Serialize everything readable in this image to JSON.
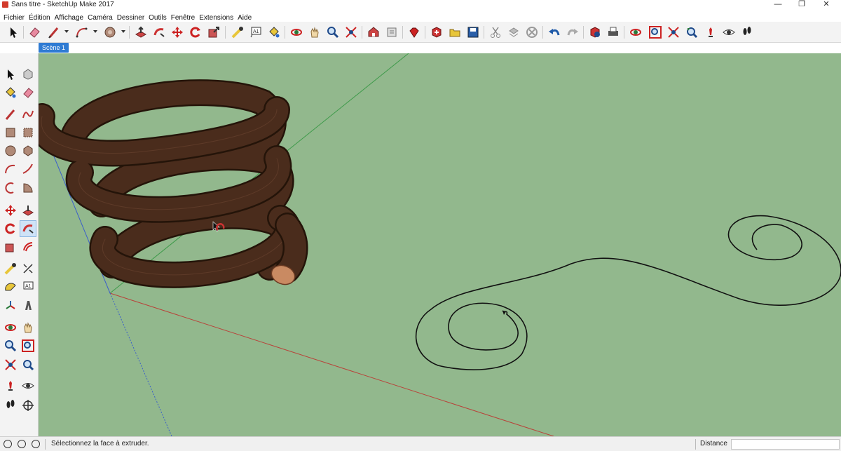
{
  "window": {
    "title": "Sans titre - SketchUp Make 2017",
    "minimize_glyph": "—",
    "maximize_glyph": "❐",
    "close_glyph": "✕"
  },
  "menu": [
    "Fichier",
    "Édition",
    "Affichage",
    "Caméra",
    "Dessiner",
    "Outils",
    "Fenêtre",
    "Extensions",
    "Aide"
  ],
  "toolbar_icons": [
    "select-icon",
    "eraser-icon",
    "line-icon",
    "arc-icon",
    "circle-icon",
    "push-pull-icon",
    "follow-me-icon",
    "move-icon",
    "rotate-icon",
    "scale-icon",
    "tape-measure-icon",
    "text-icon",
    "paint-bucket-icon",
    "orbit-icon",
    "pan-icon",
    "zoom-icon",
    "zoom-extents-icon",
    "warehouse-icon",
    "extension-warehouse-icon",
    "ruby-icon",
    "new-icon",
    "open-icon",
    "save-icon",
    "cut-icon",
    "copy-icon",
    "delete-icon",
    "undo-icon",
    "redo-icon",
    "model-info-icon",
    "print-icon",
    "orbit-icon",
    "zoom-window-icon",
    "zoom-extents-icon",
    "previous-view-icon",
    "position-camera-icon",
    "look-around-icon",
    "walk-icon"
  ],
  "scene": {
    "tab_label": "Scène 1"
  },
  "left_tools": [
    "select-icon",
    "make-component-icon",
    "paint-bucket-icon",
    "eraser-icon",
    "line-icon",
    "freehand-icon",
    "rectangle-icon",
    "rotated-rectangle-icon",
    "circle-icon",
    "polygon-icon",
    "arc-icon",
    "two-point-arc-icon",
    "three-point-arc-icon",
    "pie-icon",
    "move-icon",
    "push-pull-icon",
    "rotate-icon",
    "follow-me-icon",
    "scale-icon",
    "offset-icon",
    "tape-measure-icon",
    "dimension-icon",
    "protractor-icon",
    "text-icon",
    "axes-icon",
    "3d-text-icon",
    "orbit-icon",
    "pan-icon",
    "zoom-icon",
    "zoom-window-icon",
    "zoom-extents-icon",
    "previous-view-icon",
    "position-camera-icon",
    "look-around-icon",
    "walk-icon",
    "section-plane-icon"
  ],
  "status": {
    "message": "Sélectionnez la face à extruder.",
    "measurement_label": "Distance",
    "measurement_value": ""
  },
  "colors": {
    "viewport_bg": "#92b88d",
    "tube": "#4a2c1c",
    "tube_end": "#c98a62",
    "axis_red": "#b8433a",
    "axis_green": "#3e9a4a",
    "axis_blue": "#3b5fc9",
    "scene_tab": "#2f7bd3"
  }
}
